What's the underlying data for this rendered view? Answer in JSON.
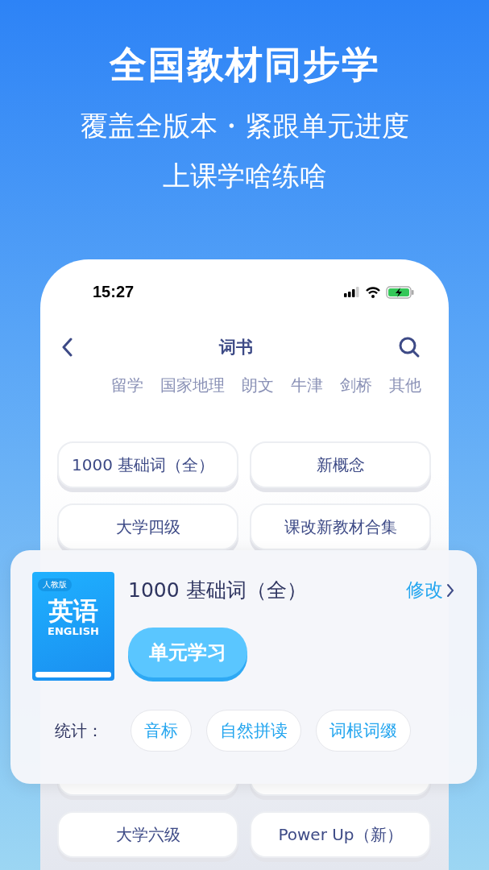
{
  "headline": "全国教材同步学",
  "subtitle_lines": [
    "覆盖全版本・紧跟单元进度",
    "上课学啥练啥"
  ],
  "phone": {
    "status_bar": {
      "time": "15:27"
    },
    "nav": {
      "title": "词书"
    },
    "tabs": [
      {
        "label": "留学"
      },
      {
        "label": "国家地理"
      },
      {
        "label": "朗文"
      },
      {
        "label": "牛津"
      },
      {
        "label": "剑桥"
      },
      {
        "label": "其他"
      }
    ],
    "books_top": [
      "1000 基础词（全）",
      "新概念",
      "大学四级",
      "课改新教材合集"
    ],
    "books_bottom": [
      "大学六级",
      "Power Up（新）"
    ]
  },
  "current_book": {
    "cover": {
      "edition": "人教版",
      "subject": "英语",
      "subject_en": "ENGLISH"
    },
    "title": "1000 基础词（全）",
    "edit_link": "修改",
    "study_button": "单元学习",
    "stats_label": "统计：",
    "stats": [
      "音标",
      "自然拼读",
      "词根词缀"
    ]
  }
}
